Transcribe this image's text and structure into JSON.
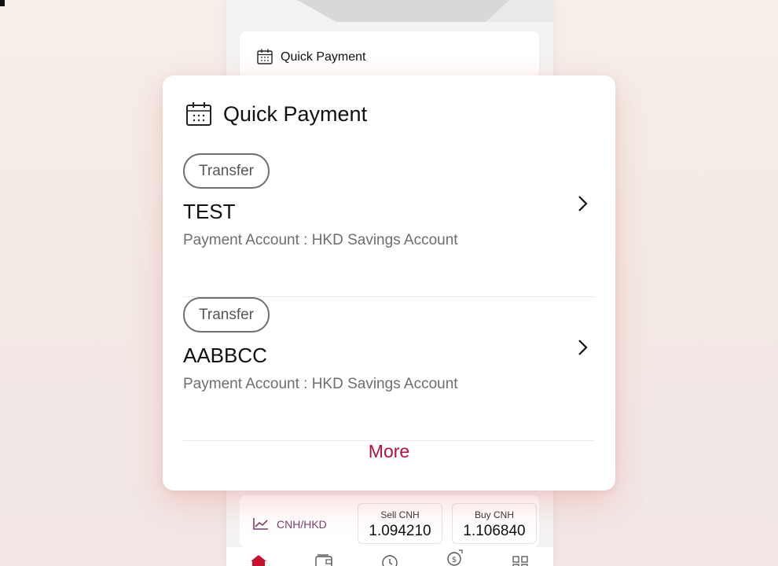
{
  "background": {
    "card_title": "Quick Payment",
    "fx": {
      "pair": "CNH/HKD",
      "sell_label": "Sell CNH",
      "sell_value": "1.094210",
      "buy_label": "Buy CNH",
      "buy_value": "1.106840"
    },
    "tabbar_icons": [
      "home-icon",
      "wallet-icon",
      "clock-icon",
      "exchange-icon",
      "grid-icon"
    ]
  },
  "popup": {
    "title": "Quick Payment",
    "header_icon": "calendar-icon",
    "items": [
      {
        "tag": "Transfer",
        "payee": "TEST",
        "account": "Payment Account : HKD Savings Account"
      },
      {
        "tag": "Transfer",
        "payee": "AABBCC",
        "account": "Payment Account : HKD Savings Account"
      }
    ],
    "more_label": "More"
  },
  "colors": {
    "accent": "#b3123d",
    "brand_red": "#c8102e",
    "fx_text": "#7a3f6d"
  }
}
